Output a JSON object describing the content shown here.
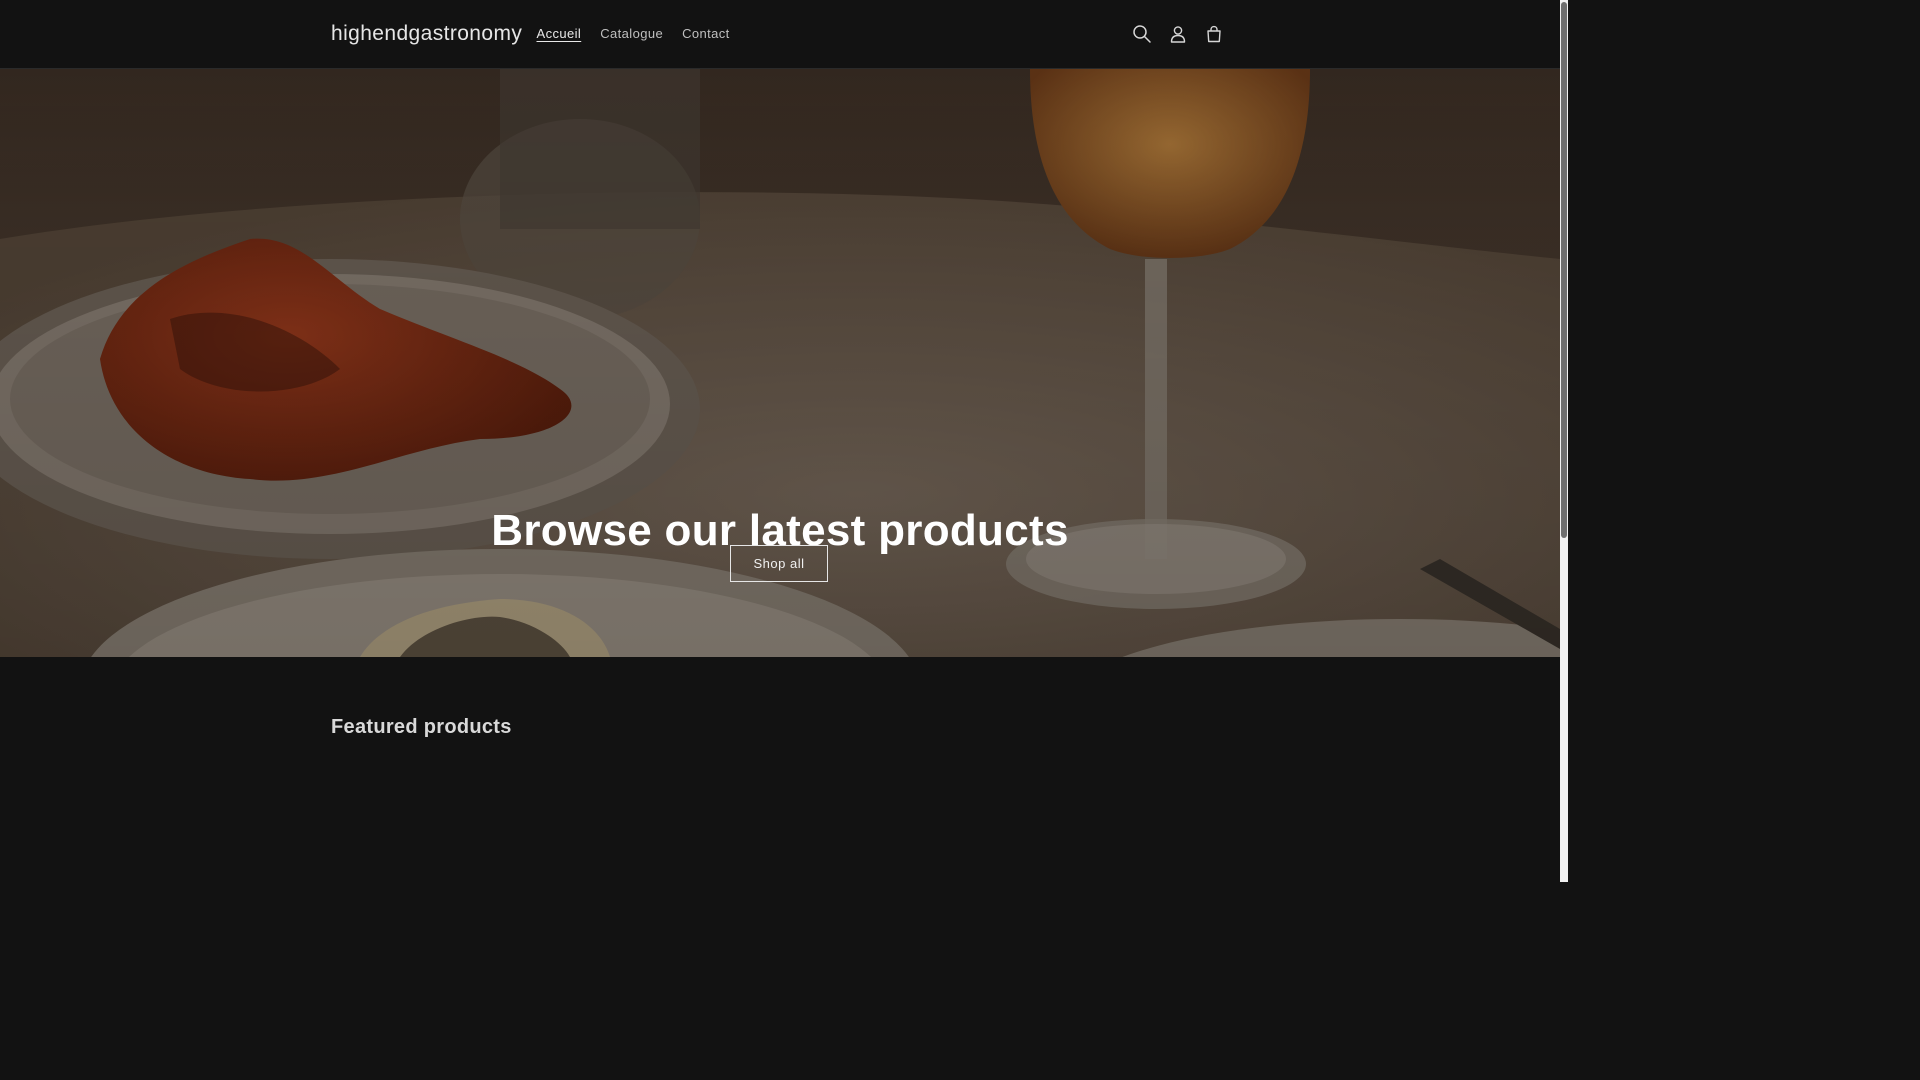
{
  "header": {
    "logo": "highendgastronomy",
    "nav": [
      {
        "label": "Accueil",
        "active": true
      },
      {
        "label": "Catalogue",
        "active": false
      },
      {
        "label": "Contact",
        "active": false
      }
    ],
    "icons": [
      "search-icon",
      "account-icon",
      "cart-icon"
    ]
  },
  "hero": {
    "title": "Browse our latest products",
    "button_label": "Shop all"
  },
  "featured": {
    "title": "Featured products"
  },
  "colors": {
    "background": "#121212",
    "text": "#ffffff",
    "hero_tint": "#4a3e33"
  }
}
